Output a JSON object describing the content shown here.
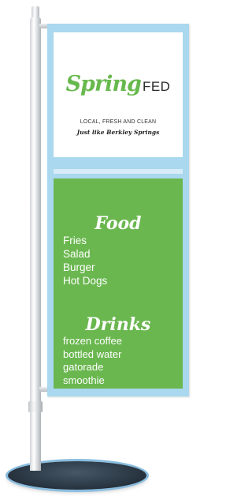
{
  "brand": {
    "script_name": "Spring",
    "caps_name": "FED",
    "tagline": "LOCAL, FRESH AND CLEAN",
    "subtagline": "Just like Berkley Springs"
  },
  "menu": {
    "food_title": "Food",
    "food_items": [
      "Fries",
      "Salad",
      "Burger",
      "Hot Dogs"
    ],
    "drinks_title": "Drinks",
    "drink_items": [
      "frozen coffee",
      "bottled water",
      "gatorade",
      "smoothie"
    ]
  },
  "colors": {
    "frame": "#a9d8ef",
    "menu_background": "#6ab64f",
    "logo_green": "#67b94e",
    "base": "#2c3a47"
  }
}
